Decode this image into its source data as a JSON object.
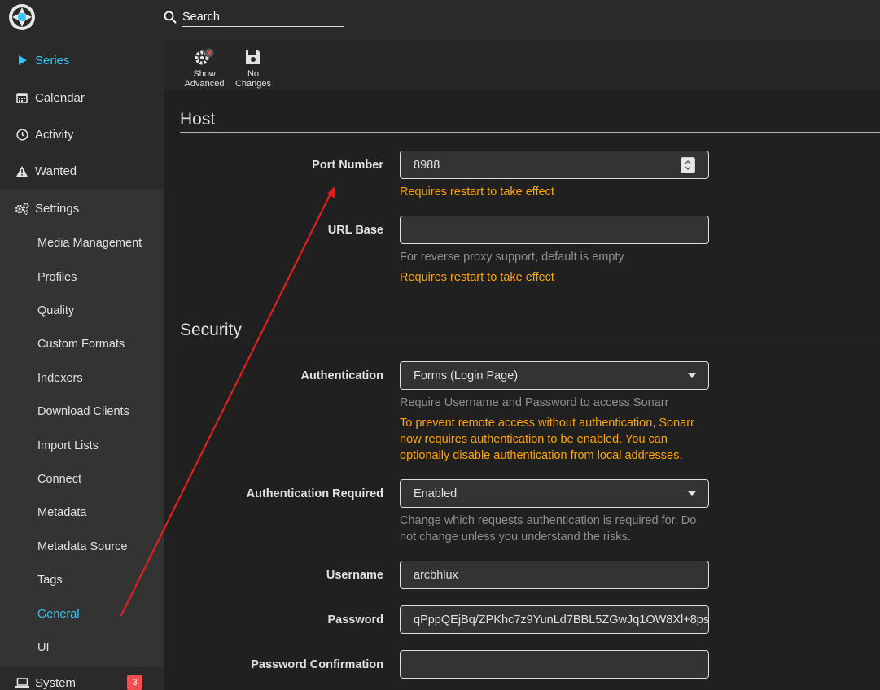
{
  "search": {
    "placeholder": "Search"
  },
  "sidebar": {
    "items": [
      {
        "label": "Series",
        "icon": "play-icon"
      },
      {
        "label": "Calendar",
        "icon": "calendar-icon"
      },
      {
        "label": "Activity",
        "icon": "clock-icon"
      },
      {
        "label": "Wanted",
        "icon": "warning-icon"
      },
      {
        "label": "Settings",
        "icon": "cogs-icon"
      },
      {
        "label": "System",
        "icon": "laptop-icon",
        "badge": "3"
      }
    ],
    "settings_sub": [
      "Media Management",
      "Profiles",
      "Quality",
      "Custom Formats",
      "Indexers",
      "Download Clients",
      "Import Lists",
      "Connect",
      "Metadata",
      "Metadata Source",
      "Tags",
      "General",
      "UI"
    ],
    "active_sub": "General"
  },
  "toolbar": {
    "show_advanced_line1": "Show",
    "show_advanced_line2": "Advanced",
    "no_changes_line1": "No",
    "no_changes_line2": "Changes"
  },
  "host": {
    "title": "Host",
    "port_label": "Port Number",
    "port_value": "8988",
    "port_warning": "Requires restart to take effect",
    "urlbase_label": "URL Base",
    "urlbase_value": "",
    "urlbase_help": "For reverse proxy support, default is empty",
    "urlbase_warning": "Requires restart to take effect"
  },
  "security": {
    "title": "Security",
    "auth_label": "Authentication",
    "auth_value": "Forms (Login Page)",
    "auth_help": "Require Username and Password to access Sonarr",
    "auth_warning": "To prevent remote access without authentication, Sonarr now requires authentication to be enabled. You can optionally disable authentication from local addresses.",
    "auth_required_label": "Authentication Required",
    "auth_required_value": "Enabled",
    "auth_required_help": "Change which requests authentication is required for. Do not change unless you understand the risks.",
    "username_label": "Username",
    "username_value": "arcbhlux",
    "password_label": "Password",
    "password_value": "qPppQEjBq/ZPKhc7z9YunLd7BBL5ZGwJq1OW8Xl+8ps",
    "password_confirm_label": "Password Confirmation",
    "password_confirm_value": ""
  },
  "colors": {
    "accent": "#35c5f4",
    "warning": "#ffa500",
    "badge": "#f05050",
    "annotation": "#e02020"
  }
}
